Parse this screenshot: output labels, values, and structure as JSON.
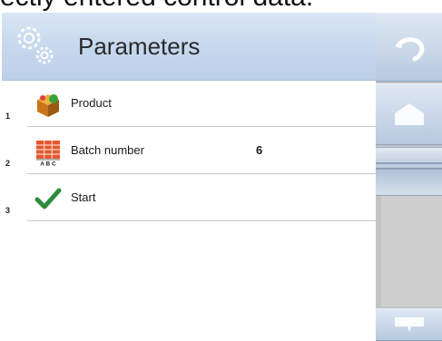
{
  "caption": {
    "text": "ectly entered control data."
  },
  "header": {
    "title": "Parameters",
    "icon": "gears-icon"
  },
  "list": {
    "items": [
      {
        "number": "1",
        "label": "Product",
        "value": "",
        "icon": "product-box-icon"
      },
      {
        "number": "2",
        "label": "Batch number",
        "value": "6",
        "icon": "batch-abc-icon"
      },
      {
        "number": "3",
        "label": "Start",
        "value": "",
        "icon": "checkmark-icon"
      }
    ]
  },
  "sidebar": {
    "buttons": [
      "back-arrow-icon",
      "home-icon",
      "scroll-down-icon"
    ],
    "scroll_position": 0
  }
}
